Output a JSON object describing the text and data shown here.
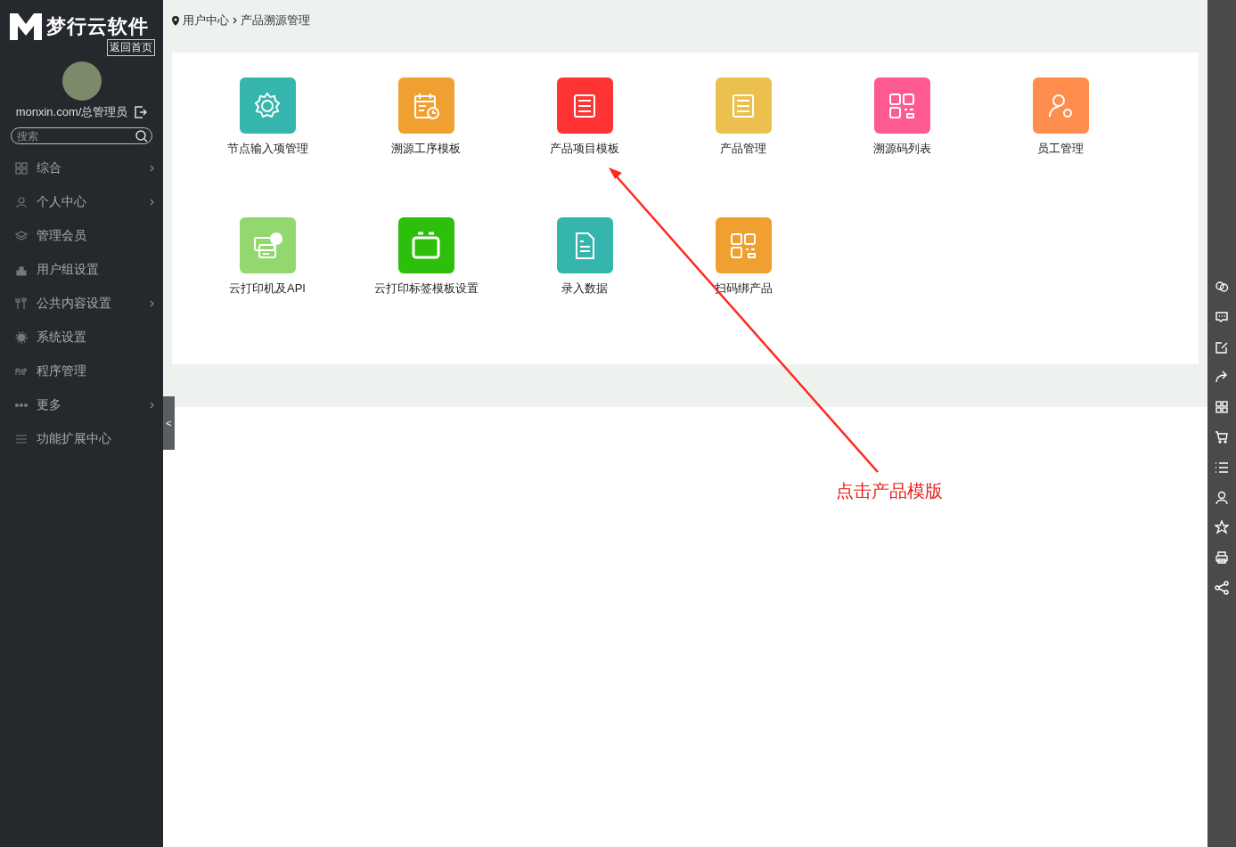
{
  "sidebar": {
    "logo_text": "梦行云软件",
    "home_link": "返回首页",
    "user": "monxin.com/总管理员",
    "search": {
      "placeholder": "搜索"
    },
    "items": [
      {
        "label": "综合",
        "expandable": true
      },
      {
        "label": "个人中心",
        "expandable": true
      },
      {
        "label": "管理会员",
        "expandable": false
      },
      {
        "label": "用户组设置",
        "expandable": false
      },
      {
        "label": "公共内容设置",
        "expandable": true
      },
      {
        "label": "系统设置",
        "expandable": false
      },
      {
        "label": "程序管理",
        "expandable": false
      },
      {
        "label": "更多",
        "expandable": true
      },
      {
        "label": "功能扩展中心",
        "expandable": false
      }
    ],
    "collapse_handle": "<"
  },
  "breadcrumb": [
    "用户中心",
    "产品溯源管理"
  ],
  "tiles": [
    {
      "label": "节点输入项管理",
      "color": "#35b5ad"
    },
    {
      "label": "溯源工序模板",
      "color": "#f0a031"
    },
    {
      "label": "产品项目模板",
      "color": "#fe3434"
    },
    {
      "label": "产品管理",
      "color": "#ecc04f"
    },
    {
      "label": "溯源码列表",
      "color": "#fd5a93"
    },
    {
      "label": "员工管理",
      "color": "#fe8d4e"
    },
    {
      "label": "云打印机及API",
      "color": "#92d86e"
    },
    {
      "label": "云打印标签模板设置",
      "color": "#2ebf0d"
    },
    {
      "label": "录入数据",
      "color": "#35b5ad"
    },
    {
      "label": "扫码绑产品",
      "color": "#f0a031"
    }
  ],
  "annotation": "点击产品模版"
}
